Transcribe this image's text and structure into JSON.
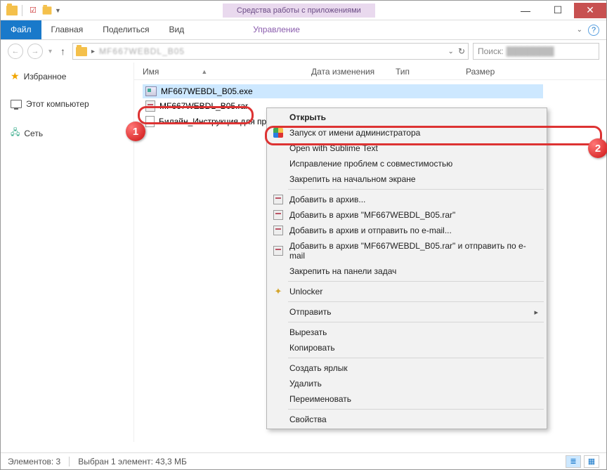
{
  "titlebar": {
    "contextual_label": "Средства работы с приложениями"
  },
  "tabs": {
    "file": "Файл",
    "home": "Главная",
    "share": "Поделиться",
    "view": "Вид",
    "manage": "Управление"
  },
  "nav": {
    "breadcrumb": "MF667WEBDL_B05",
    "refresh_hint": "↻",
    "search_label": "Поиск:",
    "search_hint": "…"
  },
  "columns": {
    "name": "Имя",
    "date": "Дата изменения",
    "type": "Тип",
    "size": "Размер"
  },
  "sidebar": {
    "favorites": "Избранное",
    "computer": "Этот компьютер",
    "network": "Сеть"
  },
  "files": [
    {
      "name": "MF667WEBDL_B05.exe",
      "icon": "exe"
    },
    {
      "name": "MF667WEBDL_B05.rar",
      "icon": "rar"
    },
    {
      "name": "Билайн_Инструкция для про",
      "icon": "txt"
    }
  ],
  "context_menu": {
    "open": "Открыть",
    "run_as_admin": "Запуск от имени администратора",
    "open_sublime": "Open with Sublime Text",
    "troubleshoot": "Исправление проблем с совместимостью",
    "pin_start": "Закрепить на начальном экране",
    "add_archive": "Добавить в архив...",
    "add_rar": "Добавить в архив \"MF667WEBDL_B05.rar\"",
    "add_email": "Добавить в архив и отправить по e-mail...",
    "add_rar_email": "Добавить в архив \"MF667WEBDL_B05.rar\" и отправить по e-mail",
    "pin_taskbar": "Закрепить на панели задач",
    "unlocker": "Unlocker",
    "send_to": "Отправить",
    "cut": "Вырезать",
    "copy": "Копировать",
    "shortcut": "Создать ярлык",
    "delete": "Удалить",
    "rename": "Переименовать",
    "properties": "Свойства"
  },
  "status": {
    "count": "Элементов: 3",
    "selection": "Выбран 1 элемент: 43,3 МБ"
  },
  "badges": {
    "one": "1",
    "two": "2"
  }
}
